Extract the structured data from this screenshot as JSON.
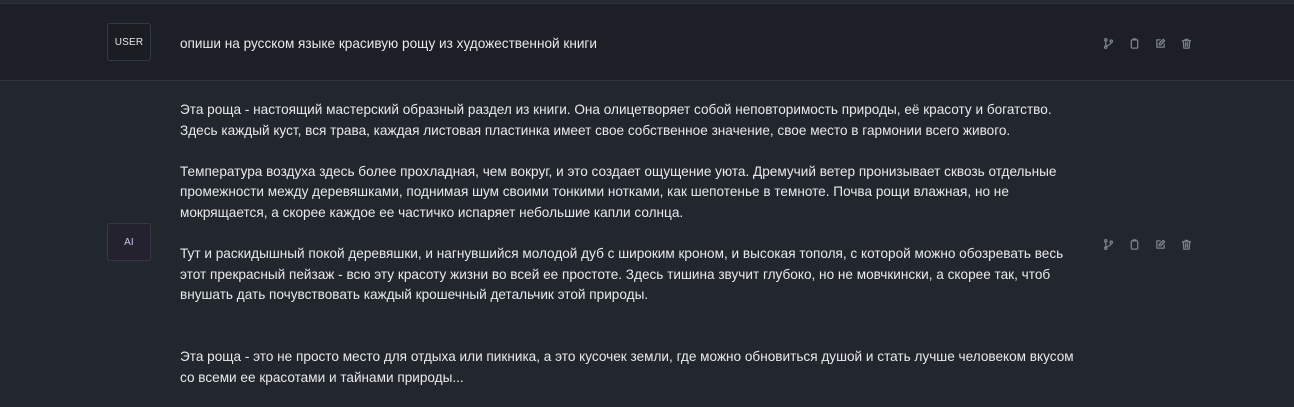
{
  "messages": [
    {
      "role_label": "USER",
      "paragraphs": [
        "опиши на русском языке  красивую рощу из художественной книги"
      ]
    },
    {
      "role_label": "AI",
      "paragraphs": [
        "Эта роща - настоящий мастерский образный раздел из книги. Она олицетворяет собой неповторимость природы, её красоту и богатство. Здесь каждый куст, вся трава, каждая листовая пластинка имеет свое собственное значение, свое место в гармонии всего живого.",
        "Температура воздуха здесь более прохладная, чем вокруг, и это создает ощущение уюта. Дремучий ветер пронизывает сквозь отдельные промежности между деревяшками, поднимая шум своими тонкими нотками, как шепотенье в темноте. Почва рощи влажная, но не мокрящается, а скорее каждое ее частичко испаряет небольшие капли солнца.",
        "Тут и раскидышный покой деревяшки, и нагнувшийся молодой дуб с широким кроном, и высокая тополя, с которой можно обозревать весь этот прекрасный пейзаж - всю эту красоту жизни во всей ее простоте. Здесь тишина звучит глубоко, но не мовчкински, а скорее так, чтоб внушать дать почувствовать каждый крошечный детальчик этой природы.",
        "Эта роща - это не просто место для отдыха или пикника, а это кусочек земли, где можно обновиться душой и стать лучше человеком вкусом со всеми ее красотами и тайнами природы..."
      ]
    }
  ],
  "actions": {
    "icons": [
      "branch-icon",
      "clipboard-icon",
      "edit-icon",
      "trash-icon"
    ]
  },
  "colors": {
    "background": "#1d2026",
    "user_row": "#1c1f25",
    "ai_row": "#22262d",
    "text": "#e8e9ec",
    "icon": "#7d828c"
  }
}
